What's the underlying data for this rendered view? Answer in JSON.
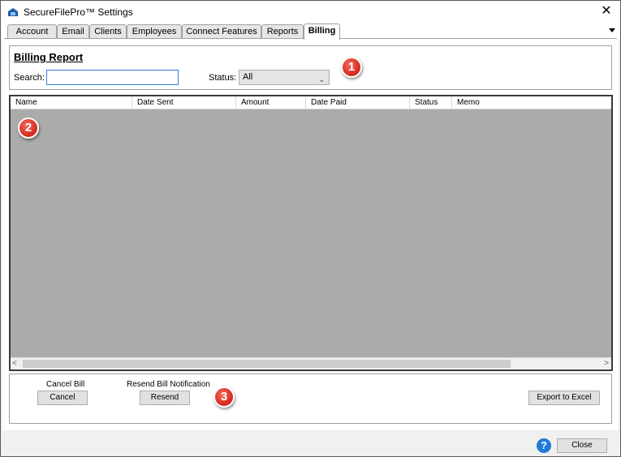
{
  "window": {
    "title": "SecureFilePro™ Settings",
    "close_glyph": "✕"
  },
  "tabs": [
    {
      "label": "Account"
    },
    {
      "label": "Email"
    },
    {
      "label": "Clients"
    },
    {
      "label": "Employees"
    },
    {
      "label": "Connect Features"
    },
    {
      "label": "Reports"
    },
    {
      "label": "Billing",
      "active": true
    }
  ],
  "billing": {
    "title": "Billing Report",
    "search_label": "Search:",
    "search_value": "",
    "status_label": "Status:",
    "status_value": "All"
  },
  "grid": {
    "columns": [
      "Name",
      "Date Sent",
      "Amount",
      "Date Paid",
      "Status",
      "Memo"
    ],
    "rows": []
  },
  "actions": {
    "cancel_caption": "Cancel Bill",
    "cancel_button": "Cancel",
    "resend_caption": "Resend Bill Notification",
    "resend_button": "Resend",
    "export_button": "Export to Excel"
  },
  "callouts": [
    "1",
    "2",
    "3"
  ],
  "footer": {
    "help_glyph": "?",
    "close_button": "Close"
  },
  "colors": {
    "accent_callout": "#d5261b",
    "grid_background": "#ababab",
    "help_icon": "#1f7ad6"
  },
  "icons": [
    "app-icon",
    "close-icon",
    "tab-overflow-icon",
    "dropdown-chevron-icon",
    "scroll-left-icon",
    "scroll-right-icon",
    "help-icon"
  ]
}
